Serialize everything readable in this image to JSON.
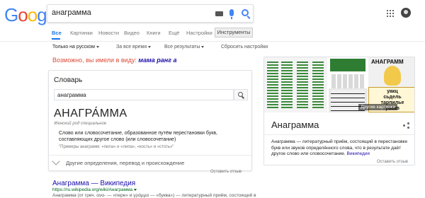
{
  "header": {
    "logo_letters": [
      {
        "ch": "G",
        "color": "#4285f4"
      },
      {
        "ch": "o",
        "color": "#ea4335"
      },
      {
        "ch": "o",
        "color": "#fbbc05"
      },
      {
        "ch": "g",
        "color": "#4285f4"
      },
      {
        "ch": "l",
        "color": "#34a853"
      },
      {
        "ch": "e",
        "color": "#ea4335"
      }
    ],
    "search_value": "анаграмма"
  },
  "tabs": [
    {
      "label": "Все",
      "active": true
    },
    {
      "label": "Картинки"
    },
    {
      "label": "Новости"
    },
    {
      "label": "Видео"
    },
    {
      "label": "Книги"
    },
    {
      "label": "Ещё"
    },
    {
      "label": "Настройки"
    }
  ],
  "tools_label": "Инструменты",
  "filters": {
    "language": "Только на русском",
    "time": "За все время",
    "results": "Все результаты",
    "reset": "Сбросить настройки"
  },
  "suggestion": {
    "prefix": "Возможно, вы имели в виду: ",
    "link": "мама ранг а"
  },
  "dictionary": {
    "title": "Словарь",
    "input_value": "анаграмма",
    "word": "АНАГРА́ММА",
    "gender": "Женский род специальное",
    "definition": "Слово или словосочетание, образованное путём перестановки букв, составляющих другое слово (или словосочетание)",
    "examples": "\"Примеры анаграмм: «пила» и «липа», «кость» и «стоть»\"",
    "more": "Другие определения, перевод и происхождение",
    "feedback": "Оставить отзыв"
  },
  "result": {
    "title": "Анаграмма — Википедия",
    "url": "https://ru.wikipedia.org/wiki/Анаграмма",
    "snippet": "Анаграмма (от греч. ανα- — «пере» и γράμμα — «буква») — литературный приём, состоящий в"
  },
  "knowledge_panel": {
    "title": "Анаграмма",
    "image_caption": "АНАГРАММ",
    "puzzle_words": [
      "уакц",
      "сьдель",
      "тарпилье",
      "увакв"
    ],
    "more_images": "Другие картинки",
    "description": "Анаграмма — литературный приём, состоящий в перестановке букв или звуков определённого слова, что в результате даёт другое слово или словосочетание.",
    "source_link": "Википедия",
    "feedback": "Оставить отзыв"
  }
}
